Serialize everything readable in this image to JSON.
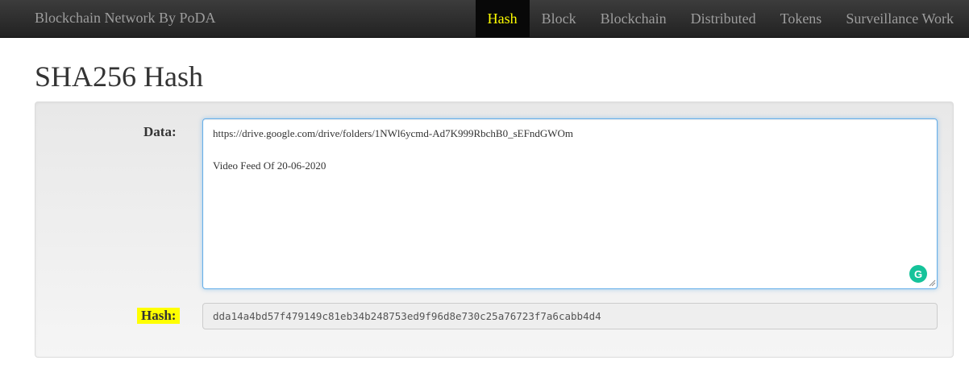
{
  "navbar": {
    "brand": "Blockchain Network By PoDA",
    "items": [
      {
        "label": "Hash",
        "active": true
      },
      {
        "label": "Block",
        "active": false
      },
      {
        "label": "Blockchain",
        "active": false
      },
      {
        "label": "Distributed",
        "active": false
      },
      {
        "label": "Tokens",
        "active": false
      },
      {
        "label": "Surveillance Work",
        "active": false
      }
    ],
    "active_color": "#ffff00"
  },
  "page": {
    "title": "SHA256 Hash"
  },
  "form": {
    "data_label": "Data:",
    "data_lines": [
      "https://drive.google.com/drive/folders/1NWl6ycmd-Ad7K999RbchB0_sEFndGWOm",
      "",
      "Video Feed Of 20-06-2020"
    ],
    "hash_label": "Hash:",
    "hash_value": "dda14a4bd57f479149c81eb34b248753ed9f96d8e730c25a76723f7a6cabb4d4",
    "grammarly_icon": "G"
  }
}
